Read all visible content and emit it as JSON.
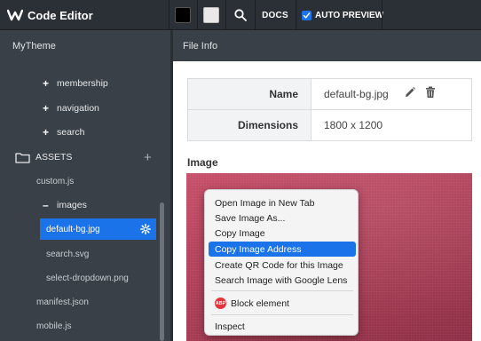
{
  "app": {
    "title": "Code Editor"
  },
  "toolbar": {
    "docs_label": "DOCS",
    "auto_preview_label": "AUTO PREVIEW",
    "auto_preview_checked": true
  },
  "header": {
    "theme_name": "MyTheme",
    "panel_title": "File Info"
  },
  "sidebar": {
    "items": [
      {
        "label": "membership",
        "kind": "folder-collapsed"
      },
      {
        "label": "navigation",
        "kind": "folder-collapsed"
      },
      {
        "label": "search",
        "kind": "folder-collapsed"
      },
      {
        "label": "ASSETS",
        "kind": "section"
      },
      {
        "label": "custom.js",
        "kind": "file"
      },
      {
        "label": "images",
        "kind": "folder-expanded"
      },
      {
        "label": "default-bg.jpg",
        "kind": "file-selected"
      },
      {
        "label": "search.svg",
        "kind": "file"
      },
      {
        "label": "select-dropdown.png",
        "kind": "file"
      },
      {
        "label": "manifest.json",
        "kind": "file"
      },
      {
        "label": "mobile.js",
        "kind": "file"
      }
    ]
  },
  "file_info": {
    "rows": [
      {
        "key": "Name",
        "value": "default-bg.jpg"
      },
      {
        "key": "Dimensions",
        "value": "1800 x 1200"
      }
    ],
    "image_label": "Image"
  },
  "context_menu": {
    "items": [
      "Open Image in New Tab",
      "Save Image As...",
      "Copy Image",
      "Copy Image Address",
      "Create QR Code for this Image",
      "Search Image with Google Lens",
      "Block element",
      "Inspect"
    ],
    "highlighted_index": 3,
    "abp_badge": "ABP"
  },
  "colors": {
    "topbar": "#2b3036",
    "sidebar": "#3a4047",
    "accent": "#1a73e8"
  },
  "icons": [
    "logo-icon",
    "search-icon",
    "checkbox-icon",
    "plus-icon",
    "folder-icon",
    "gear-icon",
    "edit-icon",
    "trash-icon",
    "abp-icon"
  ]
}
